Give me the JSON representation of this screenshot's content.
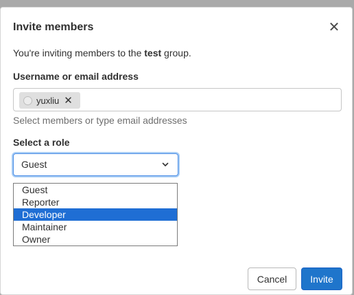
{
  "modal": {
    "title": "Invite members",
    "close_icon": "close-icon",
    "intro_prefix": "You're inviting members to the ",
    "intro_group": "test",
    "intro_suffix": " group."
  },
  "username_field": {
    "label": "Username or email address",
    "tokens": [
      {
        "label": "yuxliu",
        "avatar_icon": "avatar-placeholder-icon",
        "remove_icon": "close-icon"
      }
    ],
    "help_text": "Select members or type email addresses"
  },
  "role_field": {
    "label": "Select a role",
    "selected": "Guest",
    "chevron_icon": "chevron-down-icon",
    "options": [
      {
        "label": "Guest",
        "highlighted": false
      },
      {
        "label": "Reporter",
        "highlighted": false
      },
      {
        "label": "Developer",
        "highlighted": true
      },
      {
        "label": "Maintainer",
        "highlighted": false
      },
      {
        "label": "Owner",
        "highlighted": false
      }
    ]
  },
  "footer": {
    "cancel_label": "Cancel",
    "invite_label": "Invite"
  },
  "colors": {
    "primary": "#1f75cb",
    "highlight": "#1f6ed4",
    "focus_ring": "#4c8ee6"
  }
}
